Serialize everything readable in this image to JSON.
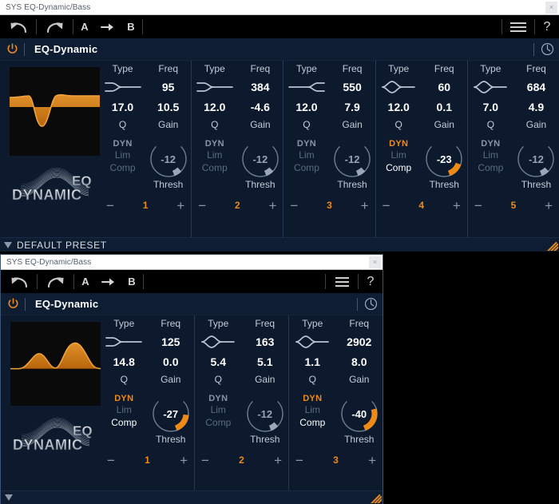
{
  "desktop": {
    "background": "#000000"
  },
  "colors": {
    "accent_orange": "#ef8a17",
    "panel_bg": "#0d1a2e",
    "header_bg": "#0f1d33",
    "toolbar_bg": "#000000",
    "text_white": "#ffffff",
    "text_muted": "#8795a6",
    "divider": "#263a56"
  },
  "windows": [
    {
      "id": "window-1",
      "titlebar": {
        "text": "SYS EQ-Dynamic/Bass",
        "close_label": "×"
      },
      "toolbar": {
        "undo_icon": "undo-arrow-icon",
        "redo_icon": "redo-arrow-icon",
        "a_label": "A",
        "copy_arrow_icon": "arrow-right-icon",
        "b_label": "B",
        "menu_icon": "hamburger-menu-icon",
        "help_label": "?"
      },
      "header": {
        "power_icon": "power-icon",
        "title": "EQ-Dynamic",
        "latency_icon": "clock-icon"
      },
      "curve": {
        "thumb_name": "eq-curve-thumbnail",
        "shape": "shelf-dip",
        "logo_top": "EQ",
        "logo_bottom": "DYNAMIC"
      },
      "band_labels": {
        "type": "Type",
        "freq": "Freq",
        "q": "Q",
        "gain": "Gain",
        "dyn": "DYN",
        "lim": "Lim",
        "comp": "Comp",
        "thresh": "Thresh",
        "minus": "−",
        "plus": "+"
      },
      "bands": [
        {
          "number": "1",
          "type_icon": "low-shelf-icon",
          "freq": "95",
          "q": "17.0",
          "gain": "10.5",
          "dyn_active": false,
          "mode": "Comp",
          "thresh": "-12",
          "thresh_pct": 22
        },
        {
          "number": "2",
          "type_icon": "low-shelf-icon",
          "freq": "384",
          "q": "12.0",
          "gain": "-4.6",
          "dyn_active": false,
          "mode": "Comp",
          "thresh": "-12",
          "thresh_pct": 22
        },
        {
          "number": "3",
          "type_icon": "high-shelf-icon",
          "freq": "550",
          "q": "12.0",
          "gain": "7.9",
          "dyn_active": false,
          "mode": "Comp",
          "thresh": "-12",
          "thresh_pct": 22
        },
        {
          "number": "4",
          "type_icon": "bell-icon",
          "freq": "60",
          "q": "12.0",
          "gain": "0.1",
          "dyn_active": true,
          "mode": "Comp",
          "thresh": "-23",
          "thresh_pct": 46
        },
        {
          "number": "5",
          "type_icon": "bell-icon",
          "freq": "684",
          "q": "7.0",
          "gain": "4.9",
          "dyn_active": false,
          "mode": "Comp",
          "thresh": "-12",
          "thresh_pct": 22
        }
      ],
      "preset": {
        "text": "DEFAULT PRESET",
        "triangle_icon": "triangle-down-icon",
        "grip_icon": "resize-grip-icon",
        "show_text": true
      }
    },
    {
      "id": "window-2",
      "titlebar": {
        "text": "SYS EQ-Dynamic/Bass",
        "close_label": "×"
      },
      "toolbar": {
        "undo_icon": "undo-arrow-icon",
        "redo_icon": "redo-arrow-icon",
        "a_label": "A",
        "copy_arrow_icon": "arrow-right-icon",
        "b_label": "B",
        "menu_icon": "hamburger-menu-icon",
        "help_label": "?"
      },
      "header": {
        "power_icon": "power-icon",
        "title": "EQ-Dynamic",
        "latency_icon": "clock-icon"
      },
      "curve": {
        "thumb_name": "eq-curve-thumbnail",
        "shape": "two-bumps",
        "logo_top": "EQ",
        "logo_bottom": "DYNAMIC"
      },
      "band_labels": {
        "type": "Type",
        "freq": "Freq",
        "q": "Q",
        "gain": "Gain",
        "dyn": "DYN",
        "lim": "Lim",
        "comp": "Comp",
        "thresh": "Thresh",
        "minus": "−",
        "plus": "+"
      },
      "bands": [
        {
          "number": "1",
          "type_icon": "low-shelf-icon",
          "freq": "125",
          "q": "14.8",
          "gain": "0.0",
          "dyn_active": true,
          "mode": "Comp",
          "thresh": "-27",
          "thresh_pct": 56
        },
        {
          "number": "2",
          "type_icon": "bell-icon",
          "freq": "163",
          "q": "5.4",
          "gain": "5.1",
          "dyn_active": false,
          "mode": "Comp",
          "thresh": "-12",
          "thresh_pct": 22
        },
        {
          "number": "3",
          "type_icon": "bell-icon",
          "freq": "2902",
          "q": "1.1",
          "gain": "8.0",
          "dyn_active": true,
          "mode": "Comp",
          "thresh": "-40",
          "thresh_pct": 78
        }
      ],
      "preset": {
        "text": "",
        "triangle_icon": "triangle-down-icon",
        "grip_icon": "resize-grip-icon",
        "show_text": false
      }
    }
  ]
}
